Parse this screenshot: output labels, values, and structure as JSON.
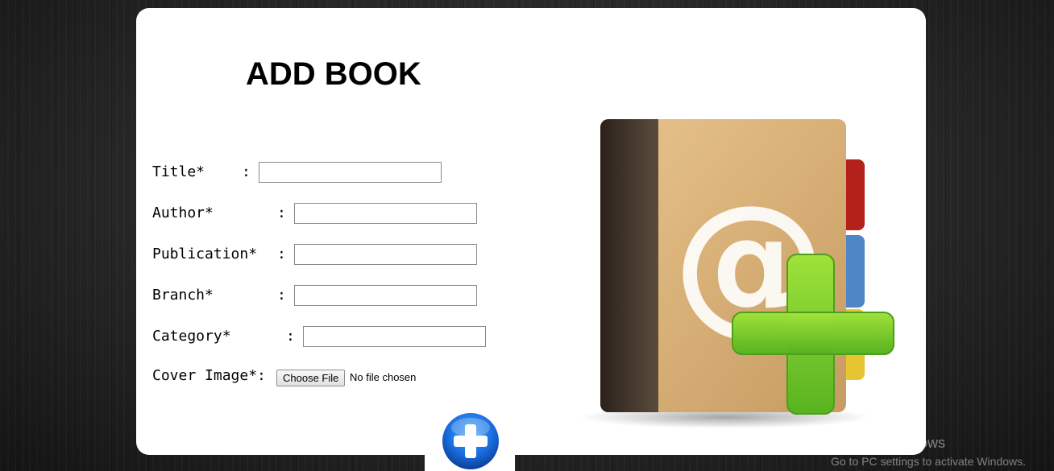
{
  "form": {
    "title": "ADD BOOK",
    "fields": [
      {
        "label": "Title*",
        "value": "",
        "placeholder": ""
      },
      {
        "label": "Author*",
        "value": "",
        "placeholder": ""
      },
      {
        "label": "Publication*",
        "value": "",
        "placeholder": ""
      },
      {
        "label": "Branch*",
        "value": "",
        "placeholder": ""
      },
      {
        "label": "Category*",
        "value": "",
        "placeholder": ""
      }
    ],
    "colon": ":",
    "cover_image": {
      "label": "Cover Image*:",
      "button_label": "Choose File",
      "status": "No file chosen"
    },
    "submit_icon": "plus-circle-icon"
  },
  "illustration": {
    "icon": "address-book-add-icon",
    "glyph": "@"
  },
  "watermark": {
    "title": "Activate Windows",
    "subtitle": "Go to PC settings to activate Windows."
  },
  "colors": {
    "card_background": "#ffffff",
    "plus_green": "#7cc92a",
    "submit_blue": "#1a6fe0",
    "book_tan": "#d8b27a",
    "tab_red": "#b3211b",
    "tab_blue": "#4f86c6",
    "tab_yellow": "#e6c530"
  }
}
